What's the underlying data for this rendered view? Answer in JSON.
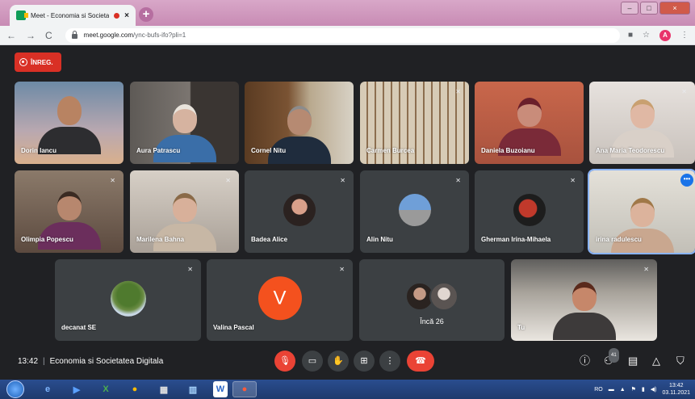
{
  "browser": {
    "tab_title": "Meet - Economia si Societate",
    "url_host": "meet.google.com",
    "url_path": "/ync-bufs-ifo?pli=1",
    "profile_initial": "A",
    "new_tab_label": "+"
  },
  "recording": {
    "label": "ÎNREG."
  },
  "participants": [
    {
      "name": "Dorin Iancu"
    },
    {
      "name": "Aura Patrascu"
    },
    {
      "name": "Cornel Nitu"
    },
    {
      "name": "Carmen Burcea"
    },
    {
      "name": "Daniela Buzoianu"
    },
    {
      "name": "Ana Maria Teodorescu"
    },
    {
      "name": "Olimpia Popescu"
    },
    {
      "name": "Marilena Bahna"
    },
    {
      "name": "Badea Alice"
    },
    {
      "name": "Alin Nitu"
    },
    {
      "name": "Gherman Irina-Mihaela"
    },
    {
      "name": "irina radulescu"
    },
    {
      "name": "decanat SE"
    },
    {
      "name": "Valina Pascal",
      "initial": "V"
    },
    {
      "name": "Încă 26"
    },
    {
      "name": "Tu"
    }
  ],
  "meeting": {
    "time": "13:42",
    "title": "Economia si Societatea Digitala",
    "participant_count": "41"
  },
  "taskbar": {
    "language": "RO",
    "clock_time": "13:42",
    "clock_date": "03.11.2021"
  }
}
